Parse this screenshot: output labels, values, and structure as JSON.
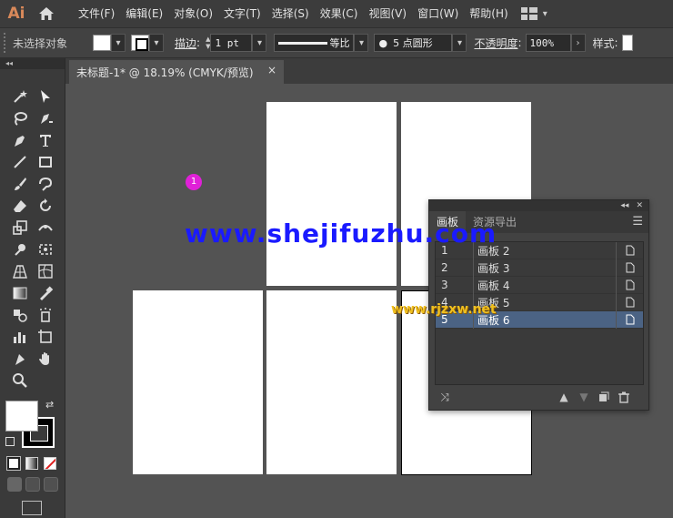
{
  "app": {
    "logo": "Ai",
    "menus": [
      "文件(F)",
      "编辑(E)",
      "对象(O)",
      "文字(T)",
      "选择(S)",
      "效果(C)",
      "视图(V)",
      "窗口(W)",
      "帮助(H)"
    ]
  },
  "control_bar": {
    "selection_status": "未选择对象",
    "stroke_label": "描边",
    "stroke_value": "1 pt",
    "stroke_profile": "等比",
    "brush": "5 点圆形",
    "opacity_label": "不透明度",
    "opacity_value": "100%",
    "style_label": "样式"
  },
  "document": {
    "tab_title": "未标题-1* @ 18.19% (CMYK/预览)",
    "close": "×"
  },
  "canvas": {
    "marker_label": "1",
    "watermark_main": "www.shejifuzhu.com",
    "watermark_small": "www.rjzxw.net"
  },
  "artboards_panel": {
    "tabs": [
      "画板",
      "资源导出"
    ],
    "rows": [
      {
        "num": "1",
        "name": "画板 2",
        "selected": false
      },
      {
        "num": "2",
        "name": "画板 3",
        "selected": false
      },
      {
        "num": "3",
        "name": "画板 4",
        "selected": false
      },
      {
        "num": "4",
        "name": "画板 5",
        "selected": false
      },
      {
        "num": "5",
        "name": "画板 6",
        "selected": true
      }
    ]
  }
}
